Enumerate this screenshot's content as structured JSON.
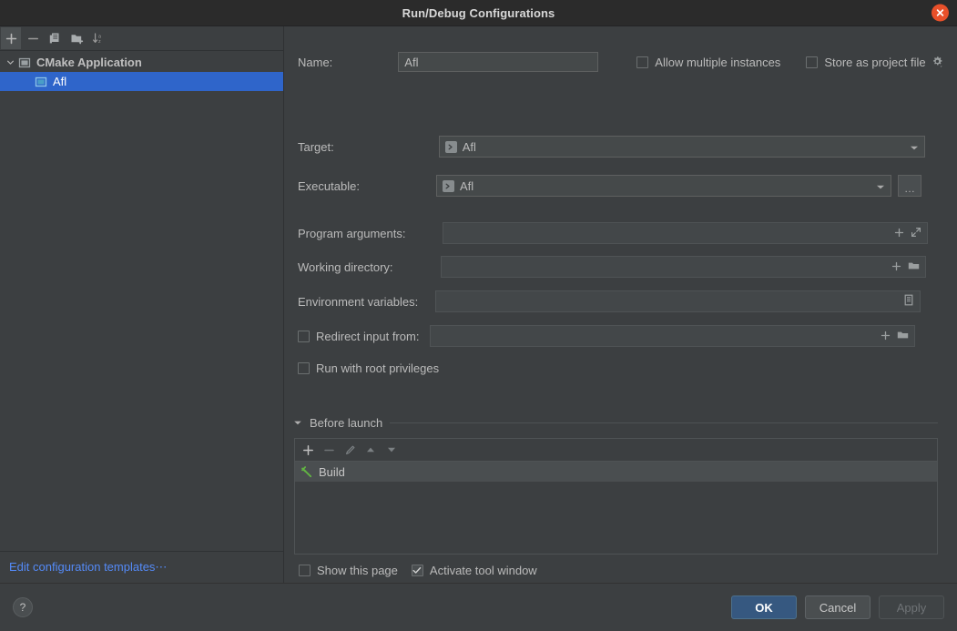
{
  "window": {
    "title": "Run/Debug Configurations",
    "close_icon": "close-icon"
  },
  "sidebar": {
    "toolbar": [
      {
        "name": "add-configuration-button",
        "glyph": "+"
      },
      {
        "name": "remove-configuration-button",
        "glyph": "−"
      },
      {
        "name": "copy-configuration-button",
        "glyph": "copy-icon"
      },
      {
        "name": "new-folder-button",
        "glyph": "folder-add-icon"
      },
      {
        "name": "sort-configurations-button",
        "glyph": "sort-az-icon"
      }
    ],
    "tree": [
      {
        "label": "CMake Application",
        "type": "group",
        "expanded": true,
        "selected": false
      },
      {
        "label": "Afl",
        "type": "child",
        "selected": true
      }
    ],
    "footer_link": "Edit configuration templates⋯"
  },
  "form": {
    "name_label": "Name:",
    "name_value": "Afl",
    "name_placeholder": "",
    "allow_multiple_instances": {
      "label": "Allow multiple instances",
      "checked": false
    },
    "store_as_project_file": {
      "label": "Store as project file",
      "checked": false,
      "gear_icon": "gear-icon"
    },
    "target_label": "Target:",
    "target_value": "Afl",
    "executable_label": "Executable:",
    "executable_value": "Afl",
    "browse_label": "…",
    "program_arguments_label": "Program arguments:",
    "program_arguments_value": "",
    "working_directory_label": "Working directory:",
    "working_directory_value": "",
    "environment_variables_label": "Environment variables:",
    "environment_variables_value": "",
    "redirect_input": {
      "label": "Redirect input from:",
      "checked": false,
      "value": ""
    },
    "run_with_root": {
      "label": "Run with root privileges",
      "checked": false
    }
  },
  "before_launch": {
    "section_title": "Before launch",
    "toolbar": [
      {
        "name": "add-task-button",
        "glyph": "+",
        "enabled": true
      },
      {
        "name": "remove-task-button",
        "glyph": "−",
        "enabled": false
      },
      {
        "name": "edit-task-button",
        "glyph": "pencil-icon",
        "enabled": false
      },
      {
        "name": "move-up-button",
        "glyph": "arrow-up-icon",
        "enabled": false
      },
      {
        "name": "move-down-button",
        "glyph": "arrow-down-icon",
        "enabled": false
      }
    ],
    "tasks": [
      {
        "label": "Build",
        "icon": "hammer-icon"
      }
    ],
    "show_this_page": {
      "label": "Show this page",
      "checked": false
    },
    "activate_tool_window": {
      "label": "Activate tool window",
      "checked": true
    }
  },
  "footer": {
    "help_label": "?",
    "ok_label": "OK",
    "cancel_label": "Cancel",
    "apply_label": "Apply"
  },
  "colors": {
    "background": "#3c3f41",
    "titlebar": "#2b2b2b",
    "selection": "#2f65ca",
    "accent_button": "#365880",
    "link": "#548af7",
    "close": "#e8502a",
    "hammer_green": "#62b543",
    "icon_blue": "#4a9ec7"
  }
}
